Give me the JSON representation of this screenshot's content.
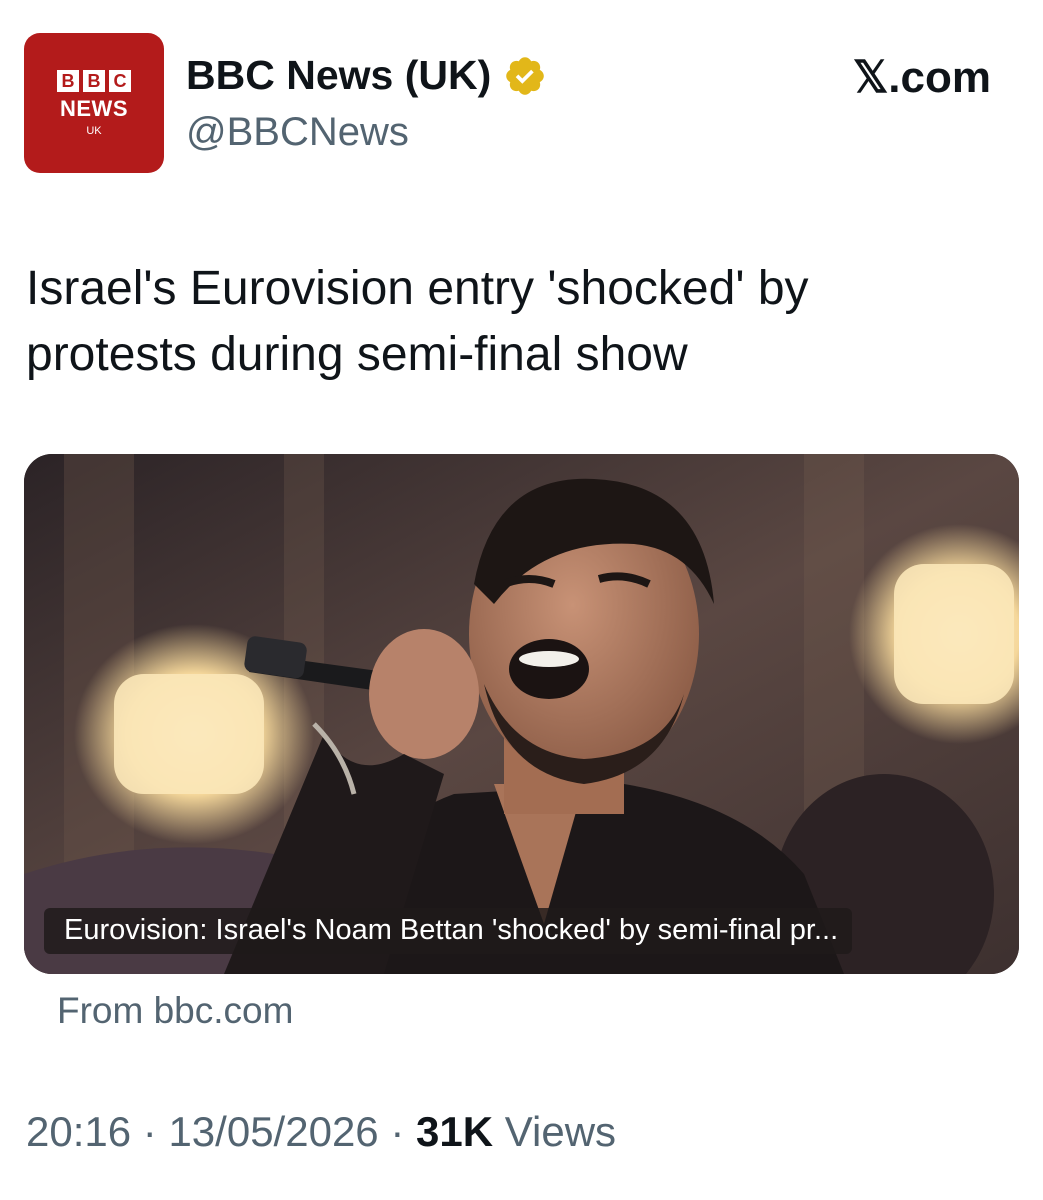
{
  "account": {
    "display_name": "BBC News (UK)",
    "handle": "@BBCNews",
    "verified_icon": "verified-badge-icon",
    "avatar": {
      "letters": [
        "B",
        "B",
        "C"
      ],
      "news": "NEWS",
      "region": "UK",
      "color": "#b31b1b"
    }
  },
  "source_brand": "𝕏.com",
  "tweet": {
    "text": "Israel's Eurovision entry 'shocked' by protests during semi-final show"
  },
  "card": {
    "caption": "Eurovision: Israel's Noam Bettan 'shocked' by semi-final pr...",
    "from": "From bbc.com"
  },
  "meta": {
    "time": "20:16",
    "date": "13/05/2026",
    "views_count": "31K",
    "views_label": "Views",
    "separator": "·"
  },
  "colors": {
    "text": "#0f1419",
    "muted": "#536471",
    "verified_gold": "#e2b719"
  }
}
